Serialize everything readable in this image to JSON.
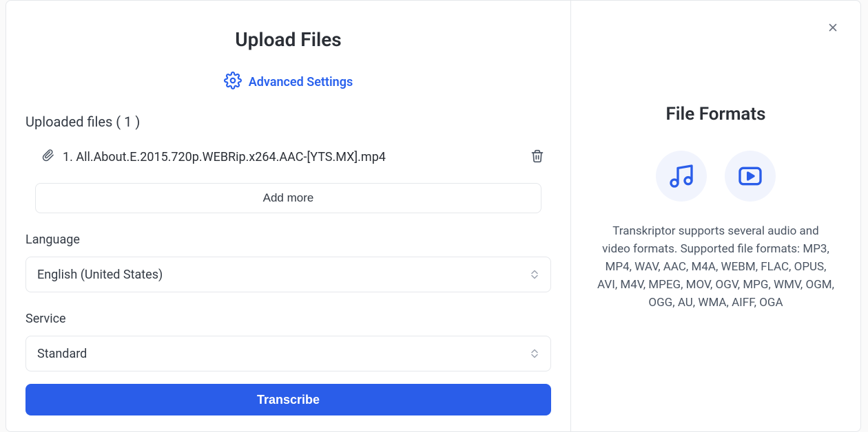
{
  "header": {
    "title": "Upload Files",
    "advanced_label": "Advanced Settings"
  },
  "uploads": {
    "count_label": "Uploaded files ( 1 )",
    "files": [
      {
        "display": "1. All.About.E.2015.720p.WEBRip.x264.AAC-[YTS.MX].mp4"
      }
    ],
    "add_more_label": "Add more"
  },
  "language": {
    "label": "Language",
    "selected": "English (United States)"
  },
  "service": {
    "label": "Service",
    "selected": "Standard"
  },
  "actions": {
    "transcribe_label": "Transcribe"
  },
  "side": {
    "title": "File Formats",
    "description": "Transkriptor supports several audio and video formats. Supported file formats: MP3, MP4, WAV, AAC, M4A, WEBM, FLAC, OPUS, AVI, M4V, MPEG, MOV, OGV, MPG, WMV, OGM, OGG, AU, WMA, AIFF, OGA"
  }
}
